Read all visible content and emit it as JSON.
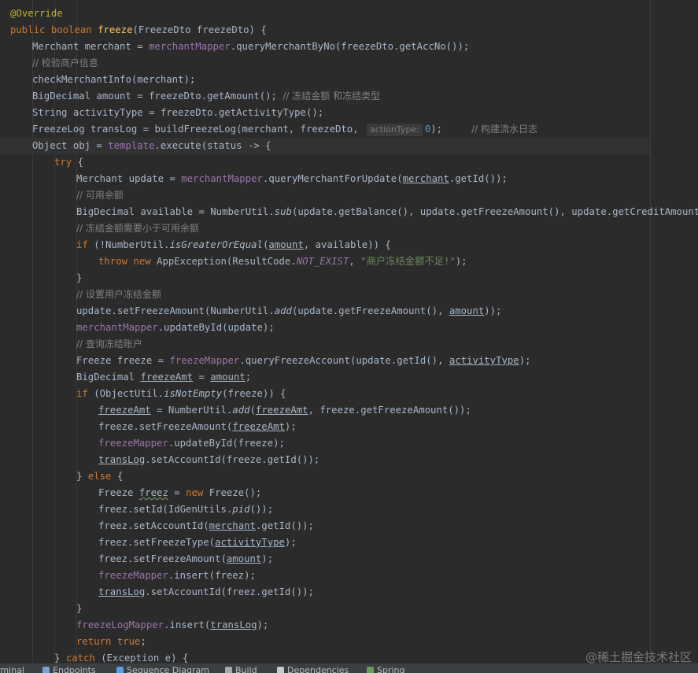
{
  "editor": {
    "lines": [
      {
        "segs": [
          [
            "@Override",
            "ann"
          ]
        ]
      },
      {
        "segs": [
          [
            "public boolean ",
            "kw"
          ],
          [
            "freeze",
            "fn"
          ],
          [
            "(FreezeDto freezeDto) {",
            ""
          ]
        ]
      },
      {
        "segs": [
          [
            "Merchant merchant = ",
            ""
          ],
          [
            "merchantMapper",
            "fld"
          ],
          [
            ".queryMerchantByNo(freezeDto.getAccNo());",
            ""
          ]
        ]
      },
      {
        "segs": [
          [
            "// 校验商户信息",
            "cmt"
          ]
        ]
      },
      {
        "segs": [
          [
            "checkMerchantInfo(merchant);",
            ""
          ]
        ]
      },
      {
        "segs": [
          [
            "BigDecimal amount = freezeDto.getAmount(); ",
            ""
          ],
          [
            "// 冻结金额 和冻结类型",
            "cmt"
          ]
        ]
      },
      {
        "segs": [
          [
            "String activityType = freezeDto.getActivityType();",
            ""
          ]
        ]
      },
      {
        "segs": [
          [
            "FreezeLog transLog = buildFreezeLog(merchant, freezeDto, ",
            ""
          ],
          [
            "actionType:",
            "hint"
          ],
          [
            "0",
            "num"
          ],
          [
            ");     ",
            ""
          ],
          [
            "// 构建流水日志",
            "cmt"
          ]
        ]
      },
      {
        "segs": [
          [
            "Object obj = ",
            ""
          ],
          [
            "template",
            "fld"
          ],
          [
            ".execute(status -> {",
            ""
          ]
        ]
      },
      {
        "segs": [
          [
            "try",
            "kw"
          ],
          [
            " {",
            ""
          ]
        ]
      },
      {
        "segs": [
          [
            "Merchant update = ",
            ""
          ],
          [
            "merchantMapper",
            "fld"
          ],
          [
            ".queryMerchantForUpdate(",
            ""
          ],
          [
            "merchant",
            "ul"
          ],
          [
            ".getId());",
            ""
          ]
        ]
      },
      {
        "segs": [
          [
            "// 可用余额",
            "cmt"
          ]
        ]
      },
      {
        "segs": [
          [
            "BigDecimal available = NumberUtil.",
            ""
          ],
          [
            "sub",
            "sc"
          ],
          [
            "(update.getBalance(), update.getFreezeAmount(), update.getCreditAmount());",
            ""
          ]
        ]
      },
      {
        "segs": [
          [
            "// 冻结金额需要小于可用余额",
            "cmt"
          ]
        ]
      },
      {
        "segs": [
          [
            "if",
            "kw"
          ],
          [
            " (!NumberUtil.",
            ""
          ],
          [
            "isGreaterOrEqual",
            "sc"
          ],
          [
            "(",
            ""
          ],
          [
            "amount",
            "ul"
          ],
          [
            ", available)) {",
            ""
          ]
        ]
      },
      {
        "segs": [
          [
            "throw new ",
            "kw"
          ],
          [
            "AppException(ResultCode.",
            ""
          ],
          [
            "NOT_EXIST",
            "cn"
          ],
          [
            ", ",
            ""
          ],
          [
            "\"商户冻结金额不足!\"",
            "str"
          ],
          [
            ");",
            ""
          ]
        ]
      },
      {
        "segs": [
          [
            "}",
            ""
          ]
        ]
      },
      {
        "segs": [
          [
            "// 设置用户冻结金额",
            "cmt"
          ]
        ]
      },
      {
        "segs": [
          [
            "update.setFreezeAmount(NumberUtil.",
            ""
          ],
          [
            "add",
            "sc"
          ],
          [
            "(update.getFreezeAmount(), ",
            ""
          ],
          [
            "amount",
            "ul"
          ],
          [
            "));",
            ""
          ]
        ]
      },
      {
        "segs": [
          [
            "merchantMapper",
            "fld"
          ],
          [
            ".updateById(update);",
            ""
          ]
        ]
      },
      {
        "segs": [
          [
            "// 查询冻结账户",
            "cmt"
          ]
        ]
      },
      {
        "segs": [
          [
            "Freeze freeze = ",
            ""
          ],
          [
            "freezeMapper",
            "fld"
          ],
          [
            ".queryFreezeAccount(update.getId(), ",
            ""
          ],
          [
            "activityType",
            "ul"
          ],
          [
            ");",
            ""
          ]
        ]
      },
      {
        "segs": [
          [
            "BigDecimal ",
            ""
          ],
          [
            "freezeAmt",
            "ul"
          ],
          [
            " = ",
            ""
          ],
          [
            "amount",
            "ul"
          ],
          [
            ";",
            ""
          ]
        ]
      },
      {
        "segs": [
          [
            "if",
            "kw"
          ],
          [
            " (ObjectUtil.",
            ""
          ],
          [
            "isNotEmpty",
            "sc"
          ],
          [
            "(freeze)) {",
            ""
          ]
        ]
      },
      {
        "segs": [
          [
            "freezeAmt",
            "ul"
          ],
          [
            " = NumberUtil.",
            ""
          ],
          [
            "add",
            "sc"
          ],
          [
            "(",
            ""
          ],
          [
            "freezeAmt",
            "ul"
          ],
          [
            ", freeze.getFreezeAmount());",
            ""
          ]
        ]
      },
      {
        "segs": [
          [
            "freeze.setFreezeAmount(",
            ""
          ],
          [
            "freezeAmt",
            "ul"
          ],
          [
            ");",
            ""
          ]
        ]
      },
      {
        "segs": [
          [
            "freezeMapper",
            "fld"
          ],
          [
            ".updateById(freeze);",
            ""
          ]
        ]
      },
      {
        "segs": [
          [
            "transLog",
            "ul"
          ],
          [
            ".setAccountId(freeze.getId());",
            ""
          ]
        ]
      },
      {
        "segs": [
          [
            "} ",
            ""
          ],
          [
            "else",
            "kw"
          ],
          [
            " {",
            ""
          ]
        ]
      },
      {
        "segs": [
          [
            "Freeze ",
            ""
          ],
          [
            "freez",
            "wavy"
          ],
          [
            " = ",
            ""
          ],
          [
            "new ",
            "kw"
          ],
          [
            "Freeze();",
            ""
          ]
        ]
      },
      {
        "segs": [
          [
            "freez.setId(IdGenUtils.",
            ""
          ],
          [
            "pid",
            "sc"
          ],
          [
            "());",
            ""
          ]
        ]
      },
      {
        "segs": [
          [
            "freez.setAccountId(",
            ""
          ],
          [
            "merchant",
            "ul"
          ],
          [
            ".getId());",
            ""
          ]
        ]
      },
      {
        "segs": [
          [
            "freez.setFreezeType(",
            ""
          ],
          [
            "activityType",
            "ul"
          ],
          [
            ");",
            ""
          ]
        ]
      },
      {
        "segs": [
          [
            "freez.setFreezeAmount(",
            ""
          ],
          [
            "amount",
            "ul"
          ],
          [
            ");",
            ""
          ]
        ]
      },
      {
        "segs": [
          [
            "freezeMapper",
            "fld"
          ],
          [
            ".insert(freez);",
            ""
          ]
        ]
      },
      {
        "segs": [
          [
            "transLog",
            "ul"
          ],
          [
            ".setAccountId(freez.getId());",
            ""
          ]
        ]
      },
      {
        "segs": [
          [
            "}",
            ""
          ]
        ]
      },
      {
        "segs": [
          [
            "freezeLogMapper",
            "fld"
          ],
          [
            ".insert(",
            ""
          ],
          [
            "transLog",
            "ul"
          ],
          [
            ");",
            ""
          ]
        ]
      },
      {
        "segs": [
          [
            "return true",
            "kw"
          ],
          [
            ";",
            ""
          ]
        ]
      },
      {
        "segs": [
          [
            "} ",
            ""
          ],
          [
            "catch",
            "kw"
          ],
          [
            " (Exception e) {",
            ""
          ]
        ]
      }
    ]
  },
  "toolwindows": [
    {
      "label": "rminal",
      "icon": "terminal-icon"
    },
    {
      "label": "Endpoints",
      "icon": "endpoints-icon"
    },
    {
      "label": "Sequence Diagram",
      "icon": "sequence-diagram-icon"
    },
    {
      "label": "Build",
      "icon": "build-icon"
    },
    {
      "label": "Dependencies",
      "icon": "dependencies-icon"
    },
    {
      "label": "Spring",
      "icon": "spring-icon"
    }
  ],
  "watermark": "@稀土掘金技术社区",
  "colors": {
    "background": "#2b2b2b",
    "keyword": "#cc7832",
    "method": "#ffc66d",
    "field": "#9876aa",
    "comment": "#808080",
    "string": "#6a8759",
    "number": "#6897bb"
  }
}
